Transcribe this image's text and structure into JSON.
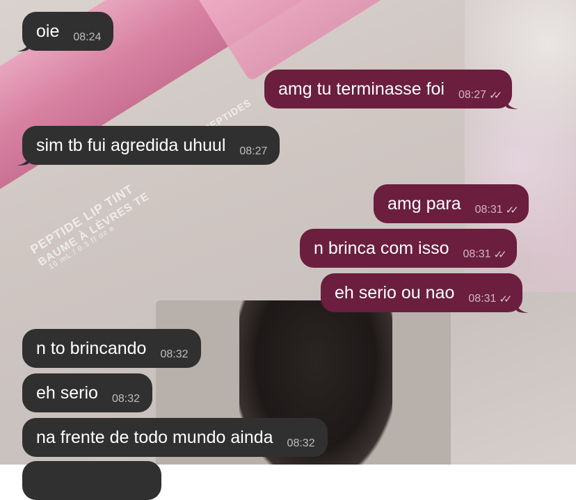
{
  "messages": [
    {
      "direction": "in",
      "text": "oie",
      "time": "08:24"
    },
    {
      "direction": "out",
      "text": "amg tu terminasse foi",
      "time": "08:27",
      "read": true
    },
    {
      "direction": "in",
      "text": "sim tb fui agredida uhuul",
      "time": "08:27"
    },
    {
      "direction": "out",
      "text": "amg para",
      "time": "08:31",
      "read": true
    },
    {
      "direction": "out",
      "text": "n brinca com isso",
      "time": "08:31",
      "read": true
    },
    {
      "direction": "out",
      "text": "eh serio ou nao",
      "time": "08:31",
      "read": true
    },
    {
      "direction": "in",
      "text": "n to brincando",
      "time": "08:32"
    },
    {
      "direction": "in",
      "text": "eh serio",
      "time": "08:32"
    },
    {
      "direction": "in",
      "text": "na frente de todo mundo ainda",
      "time": "08:32"
    }
  ],
  "wallpaper": {
    "tube_text_1": "PEPTIDE LIP TINT",
    "tube_text_2": "BAUME À LÈVRES TE",
    "cap_text": "PEPTIDES",
    "volume_text": "10 mL / 0.3 fl oz e"
  },
  "colors": {
    "incoming_bubble": "#2f302f",
    "outgoing_bubble": "#6b1e3d"
  },
  "icons": {
    "read_receipt": "double-check-icon"
  }
}
